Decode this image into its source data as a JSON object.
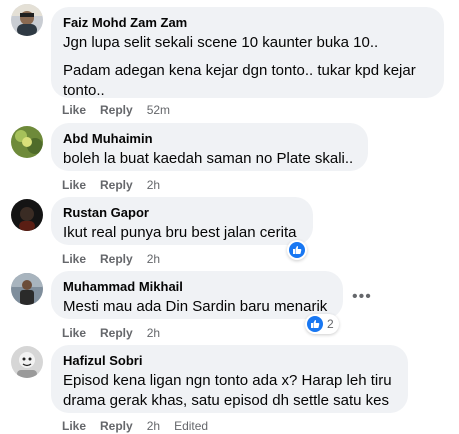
{
  "comments": [
    {
      "name": "Faiz Mohd Zam Zam",
      "lines": [
        "Jgn lupa selit sekali scene 10 kaunter buka 10..",
        "Padam adegan kena kejar dgn tonto.. tukar kpd kejar",
        "tonto.."
      ],
      "like": "Like",
      "reply": "Reply",
      "time": "52m"
    },
    {
      "name": "Abd Muhaimin",
      "lines": [
        "boleh la buat kaedah saman no Plate skali.."
      ],
      "like": "Like",
      "reply": "Reply",
      "time": "2h"
    },
    {
      "name": "Rustan Gapor",
      "lines": [
        "Ikut real punya bru best jalan cerita"
      ],
      "like": "Like",
      "reply": "Reply",
      "time": "2h"
    },
    {
      "name": "Muhammad Mikhail",
      "lines": [
        "Mesti mau ada Din Sardin baru menarik"
      ],
      "like": "Like",
      "reply": "Reply",
      "time": "2h",
      "reaction_count": "2",
      "more": "•••"
    },
    {
      "name": "Hafizul Sobri",
      "lines": [
        "Episod kena ligan ngn tonto ada x? Harap leh tiru",
        "drama gerak khas, satu episod dh settle satu kes"
      ],
      "like": "Like",
      "reply": "Reply",
      "time": "2h",
      "edited": "Edited"
    }
  ],
  "colors": {
    "bubble": "#f0f2f5",
    "like_blue": "#1877f2",
    "meta_gray": "#65676b"
  }
}
